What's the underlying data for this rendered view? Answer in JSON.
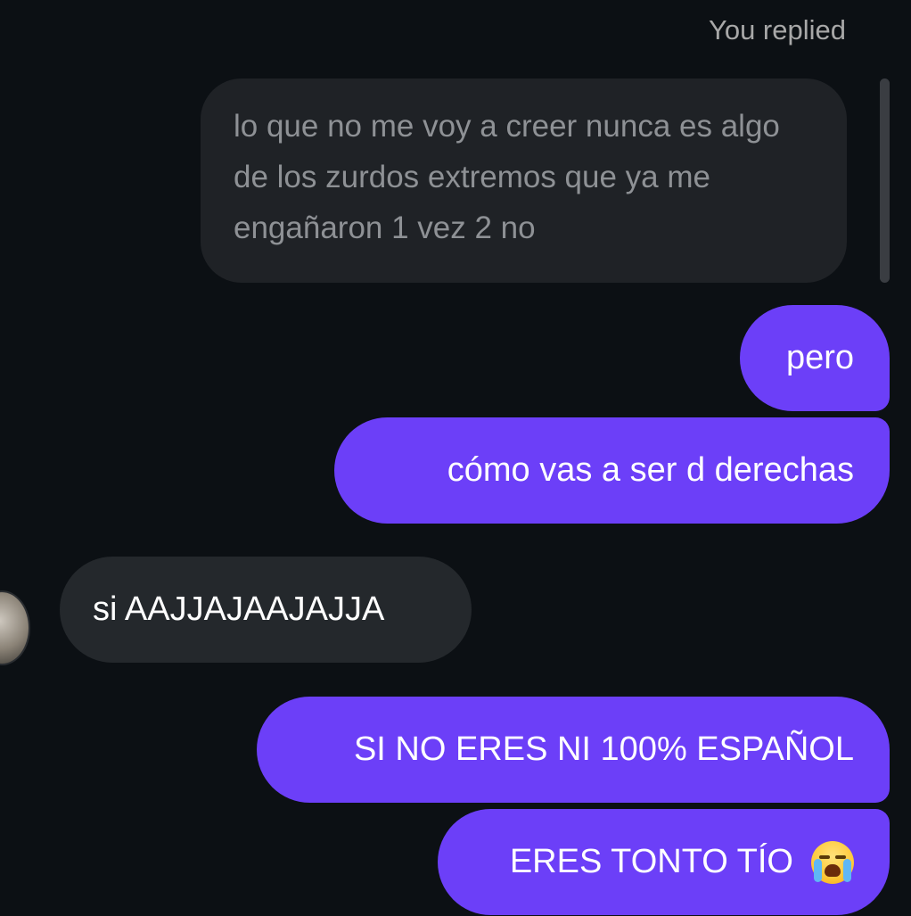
{
  "thread": {
    "status_label": "You replied",
    "replied_to_text": "lo que no me voy a creer nunca es algo de los zurdos extremos que ya me engañaron 1 vez 2 no",
    "messages": [
      {
        "sender": "me",
        "text": "pero"
      },
      {
        "sender": "me",
        "text": "cómo vas a ser d derechas"
      },
      {
        "sender": "other",
        "text": "si AAJJAJAAJAJJA"
      },
      {
        "sender": "me",
        "text": "SI NO ERES NI 100% ESPAÑOL"
      },
      {
        "sender": "me",
        "text": "ERES TONTO TÍO",
        "emoji": "loudly-crying-face-icon"
      }
    ]
  },
  "colors": {
    "background": "#0c1014",
    "outgoing_bubble": "#6c3ff8",
    "incoming_bubble": "#24282c",
    "reply_quote_bubble": "#1f2226",
    "muted_text": "#a8a8a8"
  }
}
